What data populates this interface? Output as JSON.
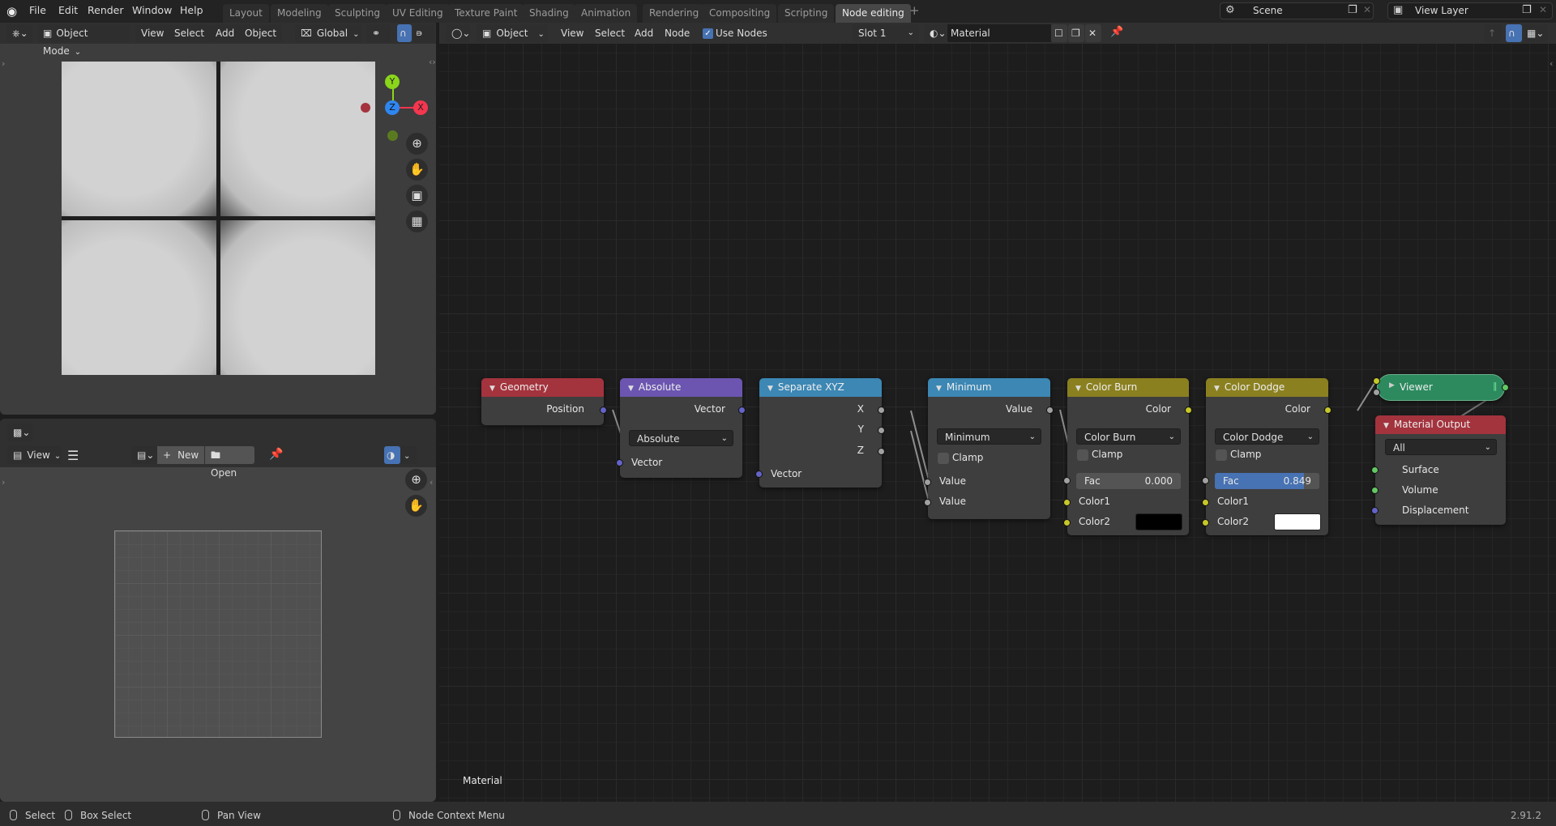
{
  "app": {
    "version": "2.91.2"
  },
  "topbar": {
    "menus": [
      "File",
      "Edit",
      "Render",
      "Window",
      "Help"
    ],
    "workspaces": [
      "Layout",
      "Modeling",
      "Sculpting",
      "UV Editing",
      "Texture Paint",
      "Shading",
      "Animation",
      "Rendering",
      "Compositing",
      "Scripting",
      "Node editing"
    ],
    "active_workspace": "Node editing",
    "add_workspace": "+",
    "scene": "Scene",
    "view_layer": "View Layer"
  },
  "viewport3d": {
    "mode": "Object Mode",
    "menus": [
      "View",
      "Select",
      "Add",
      "Object"
    ],
    "transform_orientation": "Global",
    "gizmo_axes": {
      "x": "X",
      "y": "Y",
      "z": "Z"
    },
    "axis_colors": {
      "x": "#f5364f",
      "y": "#8ad61a",
      "z": "#2f86f0"
    },
    "nav_icons": [
      "zoom-icon",
      "pan-hand-icon",
      "camera-icon",
      "grid-icon"
    ]
  },
  "image_editor": {
    "view_menu": "View",
    "new_label": "New",
    "open_label": "Open"
  },
  "node_editor": {
    "object_type": "Object",
    "menus": [
      "View",
      "Select",
      "Add",
      "Node"
    ],
    "use_nodes_label": "Use Nodes",
    "use_nodes_checked": true,
    "slot": "Slot 1",
    "material": "Material",
    "tree_label": "Material",
    "nodes": {
      "geometry": {
        "title": "Geometry",
        "color": "#a3333d",
        "outputs": [
          "Position"
        ]
      },
      "absolute": {
        "title": "Absolute",
        "color": "#6b55b0",
        "outputs": [
          "Vector"
        ],
        "operation": "Absolute",
        "inputs": [
          "Vector"
        ]
      },
      "separate_xyz": {
        "title": "Separate XYZ",
        "color": "#3c87b4",
        "outputs": [
          "X",
          "Y",
          "Z"
        ],
        "inputs": [
          "Vector"
        ]
      },
      "minimum": {
        "title": "Minimum",
        "color": "#3c87b4",
        "outputs": [
          "Value"
        ],
        "operation": "Minimum",
        "clamp_label": "Clamp",
        "clamp": false,
        "inputs": [
          "Value",
          "Value"
        ]
      },
      "color_burn": {
        "title": "Color Burn",
        "color": "#8b8020",
        "outputs": [
          "Color"
        ],
        "blend": "Color Burn",
        "clamp_label": "Clamp",
        "clamp": false,
        "fac_label": "Fac",
        "fac": "0.000",
        "fac_value": 0.0,
        "inputs": [
          "Color1",
          "Color2"
        ],
        "color2": "#000000"
      },
      "color_dodge": {
        "title": "Color Dodge",
        "color": "#8b8020",
        "outputs": [
          "Color"
        ],
        "blend": "Color Dodge",
        "clamp_label": "Clamp",
        "clamp": false,
        "fac_label": "Fac",
        "fac": "0.849",
        "fac_value": 0.849,
        "inputs": [
          "Color1",
          "Color2"
        ],
        "color2": "#ffffff"
      },
      "viewer": {
        "title": "Viewer",
        "color": "#2c8a5e"
      },
      "material_output": {
        "title": "Material Output",
        "color": "#a3333d",
        "target": "All",
        "inputs": [
          "Surface",
          "Volume",
          "Displacement"
        ]
      }
    }
  },
  "statusbar": {
    "items": [
      "Select",
      "Box Select",
      "Pan View",
      "Node Context Menu"
    ]
  }
}
